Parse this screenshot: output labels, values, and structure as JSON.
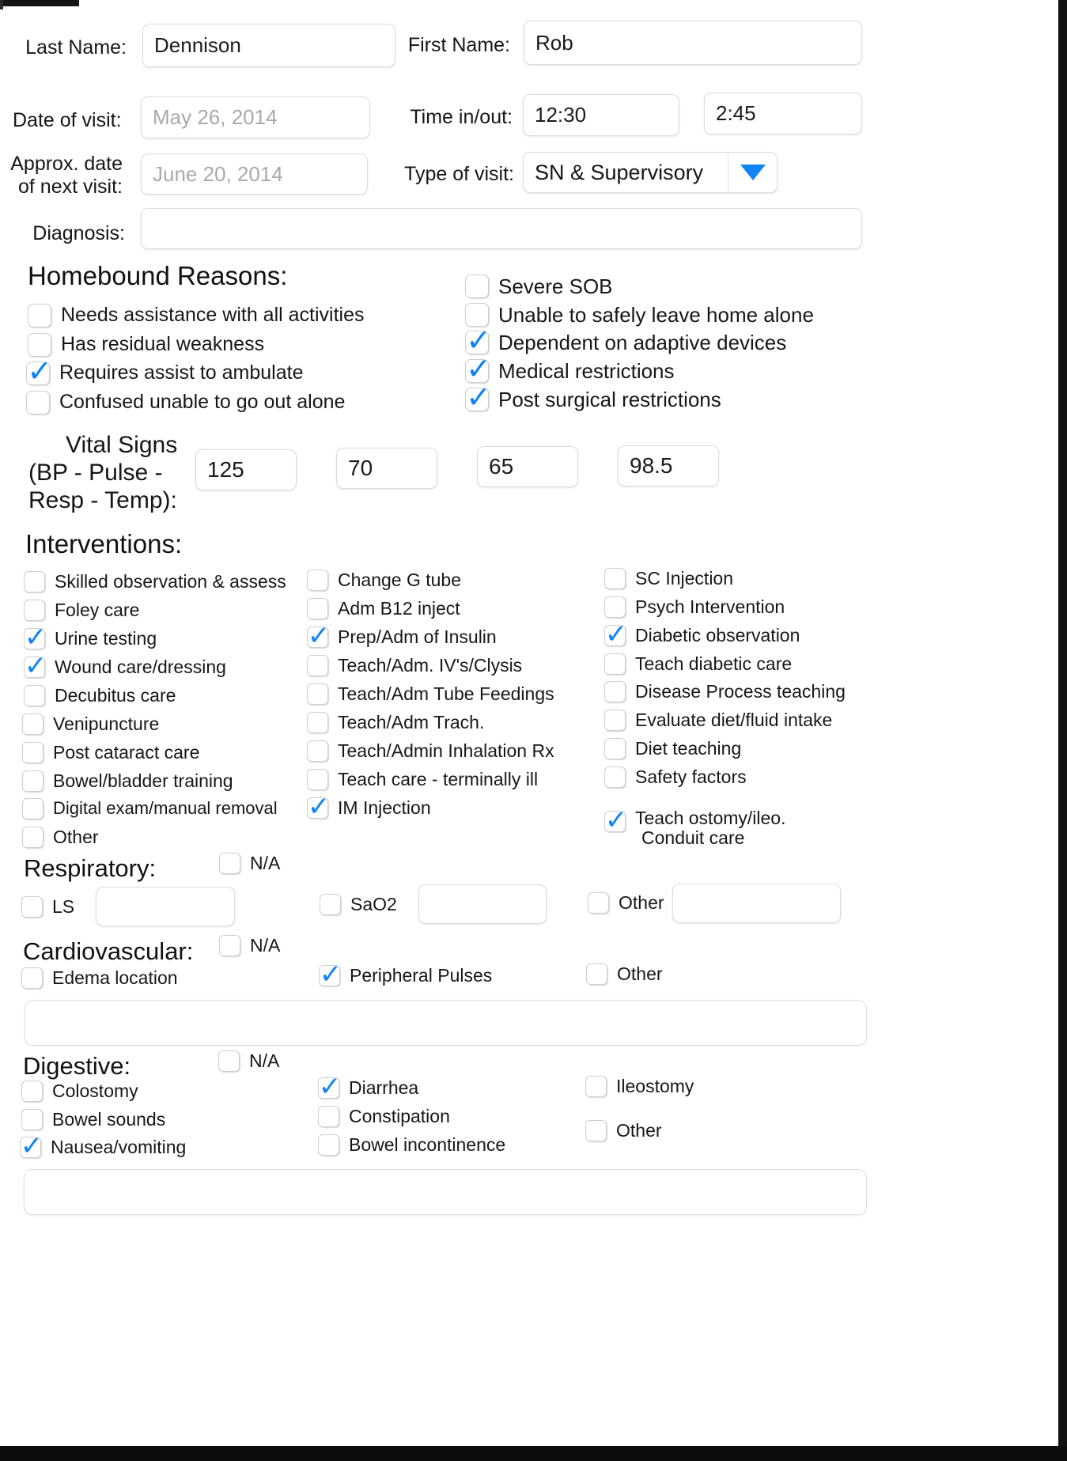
{
  "colors": {
    "accent": "#1184f5",
    "text": "#161616",
    "placeholder": "#a9a9a9",
    "field_border": "#dcdcdc"
  },
  "patient": {
    "last_name_label": "Last Name:",
    "last_name_value": "Dennison",
    "first_name_label": "First Name:",
    "first_name_value": "Rob",
    "date_of_visit_label": "Date of visit:",
    "date_of_visit_placeholder": "May 26, 2014",
    "time_in_out_label": "Time in/out:",
    "time_in_value": "12:30",
    "time_out_value": "2:45",
    "next_visit_label_line1": "Approx. date",
    "next_visit_label_line2": "of next visit:",
    "next_visit_placeholder": "June 20, 2014",
    "type_of_visit_label": "Type of visit:",
    "type_of_visit_value": "SN & Supervisory",
    "diagnosis_label": "Diagnosis:",
    "diagnosis_value": ""
  },
  "homebound": {
    "title": "Homebound Reasons:",
    "left": [
      {
        "label": "Needs assistance with all activities",
        "checked": false
      },
      {
        "label": "Has residual weakness",
        "checked": false
      },
      {
        "label": "Requires assist to ambulate",
        "checked": true
      },
      {
        "label": "Confused unable to go out alone",
        "checked": false
      }
    ],
    "right": [
      {
        "label": "Severe SOB",
        "checked": false
      },
      {
        "label": "Unable to safely leave home alone",
        "checked": false
      },
      {
        "label": "Dependent on adaptive devices",
        "checked": true
      },
      {
        "label": "Medical restrictions",
        "checked": true
      },
      {
        "label": "Post surgical restrictions",
        "checked": true
      }
    ]
  },
  "vitals": {
    "label_line1": "Vital Signs",
    "label_line2": "(BP - Pulse -",
    "label_line3": "Resp - Temp):",
    "bp_systolic": "125",
    "bp_diastolic": "70",
    "pulse_resp": "65",
    "temp": "98.5"
  },
  "interventions": {
    "title": "Interventions:",
    "col1": [
      {
        "label": "Skilled observation & assess",
        "checked": false
      },
      {
        "label": "Foley care",
        "checked": false
      },
      {
        "label": "Urine testing",
        "checked": true
      },
      {
        "label": "Wound care/dressing",
        "checked": true
      },
      {
        "label": "Decubitus care",
        "checked": false
      },
      {
        "label": "Venipuncture",
        "checked": false
      },
      {
        "label": "Post cataract care",
        "checked": false
      },
      {
        "label": "Bowel/bladder training",
        "checked": false
      },
      {
        "label": "Digital exam/manual removal",
        "checked": false
      },
      {
        "label": "Other",
        "checked": false
      }
    ],
    "col2": [
      {
        "label": "Change G tube",
        "checked": false
      },
      {
        "label": "Adm B12 inject",
        "checked": false
      },
      {
        "label": "Prep/Adm of Insulin",
        "checked": true
      },
      {
        "label": "Teach/Adm. IV's/Clysis",
        "checked": false
      },
      {
        "label": "Teach/Adm Tube Feedings",
        "checked": false
      },
      {
        "label": "Teach/Adm Trach.",
        "checked": false
      },
      {
        "label": "Teach/Admin Inhalation Rx",
        "checked": false
      },
      {
        "label": "Teach care - terminally ill",
        "checked": false
      },
      {
        "label": "IM Injection",
        "checked": true
      }
    ],
    "col3": [
      {
        "label": "SC Injection",
        "checked": false
      },
      {
        "label": "Psych Intervention",
        "checked": false
      },
      {
        "label": "Diabetic observation",
        "checked": true
      },
      {
        "label": "Teach diabetic care",
        "checked": false
      },
      {
        "label": "Disease Process teaching",
        "checked": false
      },
      {
        "label": "Evaluate diet/fluid intake",
        "checked": false
      },
      {
        "label": "Diet teaching",
        "checked": false
      },
      {
        "label": "Safety factors",
        "checked": false
      }
    ],
    "col3_last": {
      "label_line1": "Teach ostomy/ileo.",
      "label_line2": "Conduit care",
      "checked": true
    }
  },
  "respiratory": {
    "title": "Respiratory:",
    "na_label": "N/A",
    "na_checked": false,
    "ls_label": "LS",
    "ls_checked": false,
    "ls_value": "",
    "sao2_label": "SaO2",
    "sao2_checked": false,
    "sao2_value": "",
    "other_label": "Other",
    "other_checked": false,
    "other_value": ""
  },
  "cardiovascular": {
    "title": "Cardiovascular:",
    "na_label": "N/A",
    "na_checked": false,
    "edema_label": "Edema location",
    "edema_checked": false,
    "pulses_label": "Peripheral Pulses",
    "pulses_checked": true,
    "other_label": "Other",
    "other_checked": false,
    "notes_value": ""
  },
  "digestive": {
    "title": "Digestive:",
    "na_label": "N/A",
    "na_checked": false,
    "col1": [
      {
        "label": "Colostomy",
        "checked": false
      },
      {
        "label": "Bowel sounds",
        "checked": false
      },
      {
        "label": "Nausea/vomiting",
        "checked": true
      }
    ],
    "col2": [
      {
        "label": "Diarrhea",
        "checked": true
      },
      {
        "label": "Constipation",
        "checked": false
      },
      {
        "label": "Bowel incontinence",
        "checked": false
      }
    ],
    "col3": [
      {
        "label": "Ileostomy",
        "checked": false
      },
      {
        "label": "Other",
        "checked": false
      }
    ],
    "notes_value": ""
  }
}
